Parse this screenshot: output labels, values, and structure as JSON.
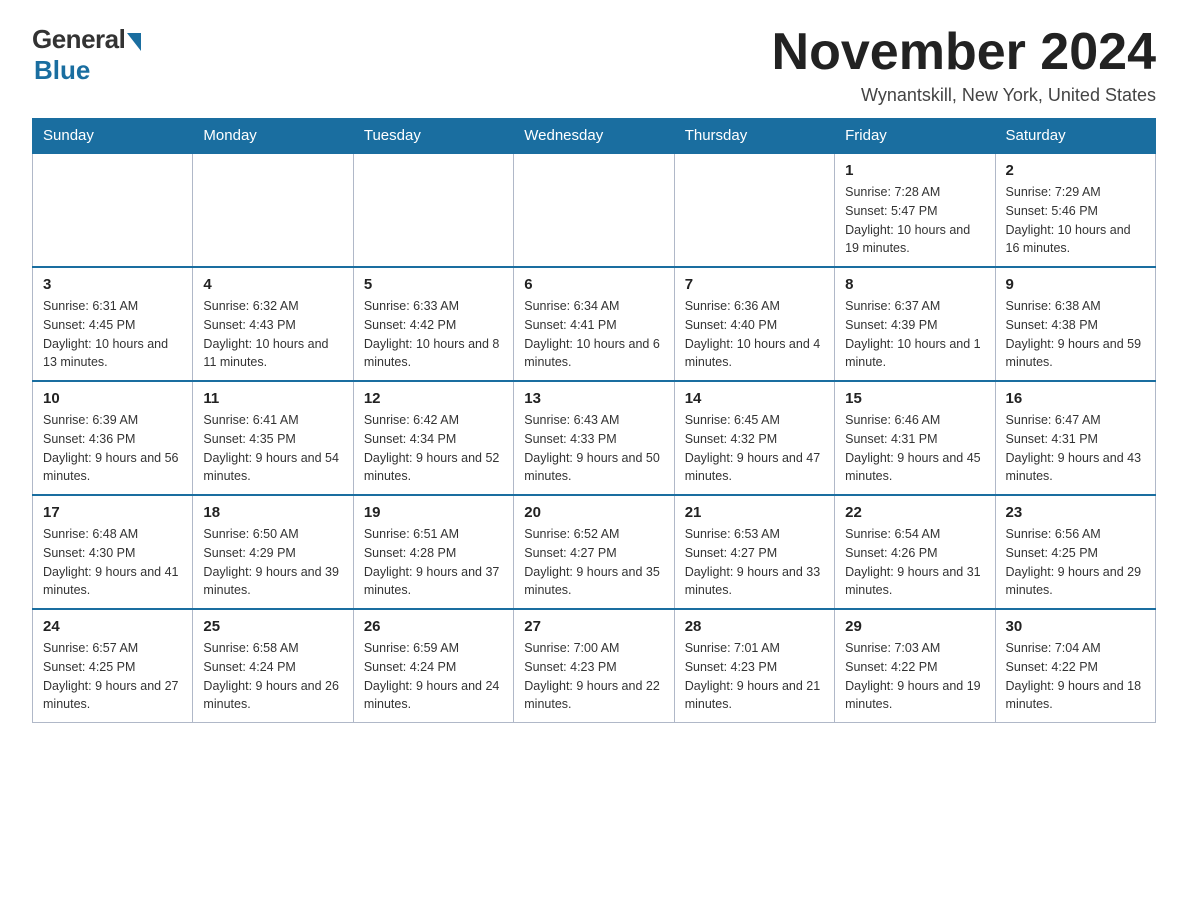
{
  "header": {
    "logo_general": "General",
    "logo_blue": "Blue",
    "month_title": "November 2024",
    "location": "Wynantskill, New York, United States"
  },
  "days_of_week": [
    "Sunday",
    "Monday",
    "Tuesday",
    "Wednesday",
    "Thursday",
    "Friday",
    "Saturday"
  ],
  "weeks": [
    [
      {
        "day": "",
        "sunrise": "",
        "sunset": "",
        "daylight": ""
      },
      {
        "day": "",
        "sunrise": "",
        "sunset": "",
        "daylight": ""
      },
      {
        "day": "",
        "sunrise": "",
        "sunset": "",
        "daylight": ""
      },
      {
        "day": "",
        "sunrise": "",
        "sunset": "",
        "daylight": ""
      },
      {
        "day": "",
        "sunrise": "",
        "sunset": "",
        "daylight": ""
      },
      {
        "day": "1",
        "sunrise": "Sunrise: 7:28 AM",
        "sunset": "Sunset: 5:47 PM",
        "daylight": "Daylight: 10 hours and 19 minutes."
      },
      {
        "day": "2",
        "sunrise": "Sunrise: 7:29 AM",
        "sunset": "Sunset: 5:46 PM",
        "daylight": "Daylight: 10 hours and 16 minutes."
      }
    ],
    [
      {
        "day": "3",
        "sunrise": "Sunrise: 6:31 AM",
        "sunset": "Sunset: 4:45 PM",
        "daylight": "Daylight: 10 hours and 13 minutes."
      },
      {
        "day": "4",
        "sunrise": "Sunrise: 6:32 AM",
        "sunset": "Sunset: 4:43 PM",
        "daylight": "Daylight: 10 hours and 11 minutes."
      },
      {
        "day": "5",
        "sunrise": "Sunrise: 6:33 AM",
        "sunset": "Sunset: 4:42 PM",
        "daylight": "Daylight: 10 hours and 8 minutes."
      },
      {
        "day": "6",
        "sunrise": "Sunrise: 6:34 AM",
        "sunset": "Sunset: 4:41 PM",
        "daylight": "Daylight: 10 hours and 6 minutes."
      },
      {
        "day": "7",
        "sunrise": "Sunrise: 6:36 AM",
        "sunset": "Sunset: 4:40 PM",
        "daylight": "Daylight: 10 hours and 4 minutes."
      },
      {
        "day": "8",
        "sunrise": "Sunrise: 6:37 AM",
        "sunset": "Sunset: 4:39 PM",
        "daylight": "Daylight: 10 hours and 1 minute."
      },
      {
        "day": "9",
        "sunrise": "Sunrise: 6:38 AM",
        "sunset": "Sunset: 4:38 PM",
        "daylight": "Daylight: 9 hours and 59 minutes."
      }
    ],
    [
      {
        "day": "10",
        "sunrise": "Sunrise: 6:39 AM",
        "sunset": "Sunset: 4:36 PM",
        "daylight": "Daylight: 9 hours and 56 minutes."
      },
      {
        "day": "11",
        "sunrise": "Sunrise: 6:41 AM",
        "sunset": "Sunset: 4:35 PM",
        "daylight": "Daylight: 9 hours and 54 minutes."
      },
      {
        "day": "12",
        "sunrise": "Sunrise: 6:42 AM",
        "sunset": "Sunset: 4:34 PM",
        "daylight": "Daylight: 9 hours and 52 minutes."
      },
      {
        "day": "13",
        "sunrise": "Sunrise: 6:43 AM",
        "sunset": "Sunset: 4:33 PM",
        "daylight": "Daylight: 9 hours and 50 minutes."
      },
      {
        "day": "14",
        "sunrise": "Sunrise: 6:45 AM",
        "sunset": "Sunset: 4:32 PM",
        "daylight": "Daylight: 9 hours and 47 minutes."
      },
      {
        "day": "15",
        "sunrise": "Sunrise: 6:46 AM",
        "sunset": "Sunset: 4:31 PM",
        "daylight": "Daylight: 9 hours and 45 minutes."
      },
      {
        "day": "16",
        "sunrise": "Sunrise: 6:47 AM",
        "sunset": "Sunset: 4:31 PM",
        "daylight": "Daylight: 9 hours and 43 minutes."
      }
    ],
    [
      {
        "day": "17",
        "sunrise": "Sunrise: 6:48 AM",
        "sunset": "Sunset: 4:30 PM",
        "daylight": "Daylight: 9 hours and 41 minutes."
      },
      {
        "day": "18",
        "sunrise": "Sunrise: 6:50 AM",
        "sunset": "Sunset: 4:29 PM",
        "daylight": "Daylight: 9 hours and 39 minutes."
      },
      {
        "day": "19",
        "sunrise": "Sunrise: 6:51 AM",
        "sunset": "Sunset: 4:28 PM",
        "daylight": "Daylight: 9 hours and 37 minutes."
      },
      {
        "day": "20",
        "sunrise": "Sunrise: 6:52 AM",
        "sunset": "Sunset: 4:27 PM",
        "daylight": "Daylight: 9 hours and 35 minutes."
      },
      {
        "day": "21",
        "sunrise": "Sunrise: 6:53 AM",
        "sunset": "Sunset: 4:27 PM",
        "daylight": "Daylight: 9 hours and 33 minutes."
      },
      {
        "day": "22",
        "sunrise": "Sunrise: 6:54 AM",
        "sunset": "Sunset: 4:26 PM",
        "daylight": "Daylight: 9 hours and 31 minutes."
      },
      {
        "day": "23",
        "sunrise": "Sunrise: 6:56 AM",
        "sunset": "Sunset: 4:25 PM",
        "daylight": "Daylight: 9 hours and 29 minutes."
      }
    ],
    [
      {
        "day": "24",
        "sunrise": "Sunrise: 6:57 AM",
        "sunset": "Sunset: 4:25 PM",
        "daylight": "Daylight: 9 hours and 27 minutes."
      },
      {
        "day": "25",
        "sunrise": "Sunrise: 6:58 AM",
        "sunset": "Sunset: 4:24 PM",
        "daylight": "Daylight: 9 hours and 26 minutes."
      },
      {
        "day": "26",
        "sunrise": "Sunrise: 6:59 AM",
        "sunset": "Sunset: 4:24 PM",
        "daylight": "Daylight: 9 hours and 24 minutes."
      },
      {
        "day": "27",
        "sunrise": "Sunrise: 7:00 AM",
        "sunset": "Sunset: 4:23 PM",
        "daylight": "Daylight: 9 hours and 22 minutes."
      },
      {
        "day": "28",
        "sunrise": "Sunrise: 7:01 AM",
        "sunset": "Sunset: 4:23 PM",
        "daylight": "Daylight: 9 hours and 21 minutes."
      },
      {
        "day": "29",
        "sunrise": "Sunrise: 7:03 AM",
        "sunset": "Sunset: 4:22 PM",
        "daylight": "Daylight: 9 hours and 19 minutes."
      },
      {
        "day": "30",
        "sunrise": "Sunrise: 7:04 AM",
        "sunset": "Sunset: 4:22 PM",
        "daylight": "Daylight: 9 hours and 18 minutes."
      }
    ]
  ]
}
